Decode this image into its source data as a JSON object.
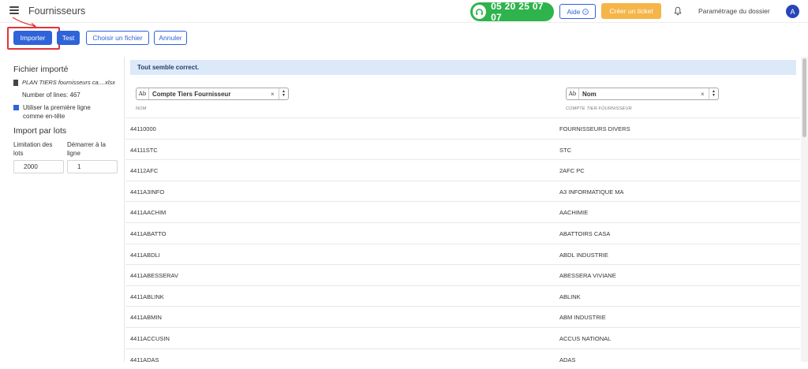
{
  "header": {
    "title": "Fournisseurs",
    "phone": "05 20 25 07 07",
    "help_label": "Aide",
    "ticket_label": "Créer un ticket",
    "settings_label": "Paramétrage du dossier",
    "avatar_initial": "A"
  },
  "toolbar": {
    "import_label": "Importer",
    "test_label": "Test",
    "choose_file_label": "Choisir un fichier",
    "cancel_label": "Annuler"
  },
  "left_panel": {
    "imported_file_title": "Fichier importé",
    "file_name": "PLAN TIERS fournisseurs ca....xlsx",
    "line_count": "Number of lines: 467",
    "first_row_header_line1": "Utiliser la première ligne",
    "first_row_header_line2": "comme en-tête",
    "batch_title": "Import par lots",
    "batch_limit_label_line1": "Limitation des",
    "batch_limit_label_line2": "lots",
    "start_row_label_line1": "Démarrer à la",
    "start_row_label_line2": "ligne",
    "batch_limit_value": "2000",
    "start_row_value": "1"
  },
  "main": {
    "alert": "Tout semble correct.",
    "columns": [
      {
        "type_badge": "Ab",
        "selected": "Compte Tiers Fournisseur",
        "source": "NOM"
      },
      {
        "type_badge": "Ab",
        "selected": "Nom",
        "source": "COMPTE TIER FOURNISSEUR"
      }
    ],
    "rows": [
      [
        "44110000",
        "FOURNISSEURS DIVERS"
      ],
      [
        "44111STC",
        "STC"
      ],
      [
        "44112AFC",
        "2AFC PC"
      ],
      [
        "4411A3INFO",
        "A3 INFORMATIQUE MA"
      ],
      [
        "4411AACHIM",
        "AACHIMIE"
      ],
      [
        "4411ABATTO",
        "ABATTOIRS CASA"
      ],
      [
        "4411ABDLI",
        "ABDL INDUSTRIE"
      ],
      [
        "4411ABESSERAV",
        "ABESSERA VIVIANE"
      ],
      [
        "4411ABLINK",
        "ABLINK"
      ],
      [
        "4411ABMIN",
        "ABM INDUSTRIE"
      ],
      [
        "4411ACCUSIN",
        "ACCUS NATIONAL"
      ],
      [
        "4411ADAS",
        "ADAS"
      ]
    ]
  },
  "colors": {
    "primary": "#2f63d9",
    "phone_green": "#2fb34c",
    "ticket_orange": "#f5b548",
    "alert_bg": "#dbe9f9",
    "highlight_red": "#e2343a"
  }
}
